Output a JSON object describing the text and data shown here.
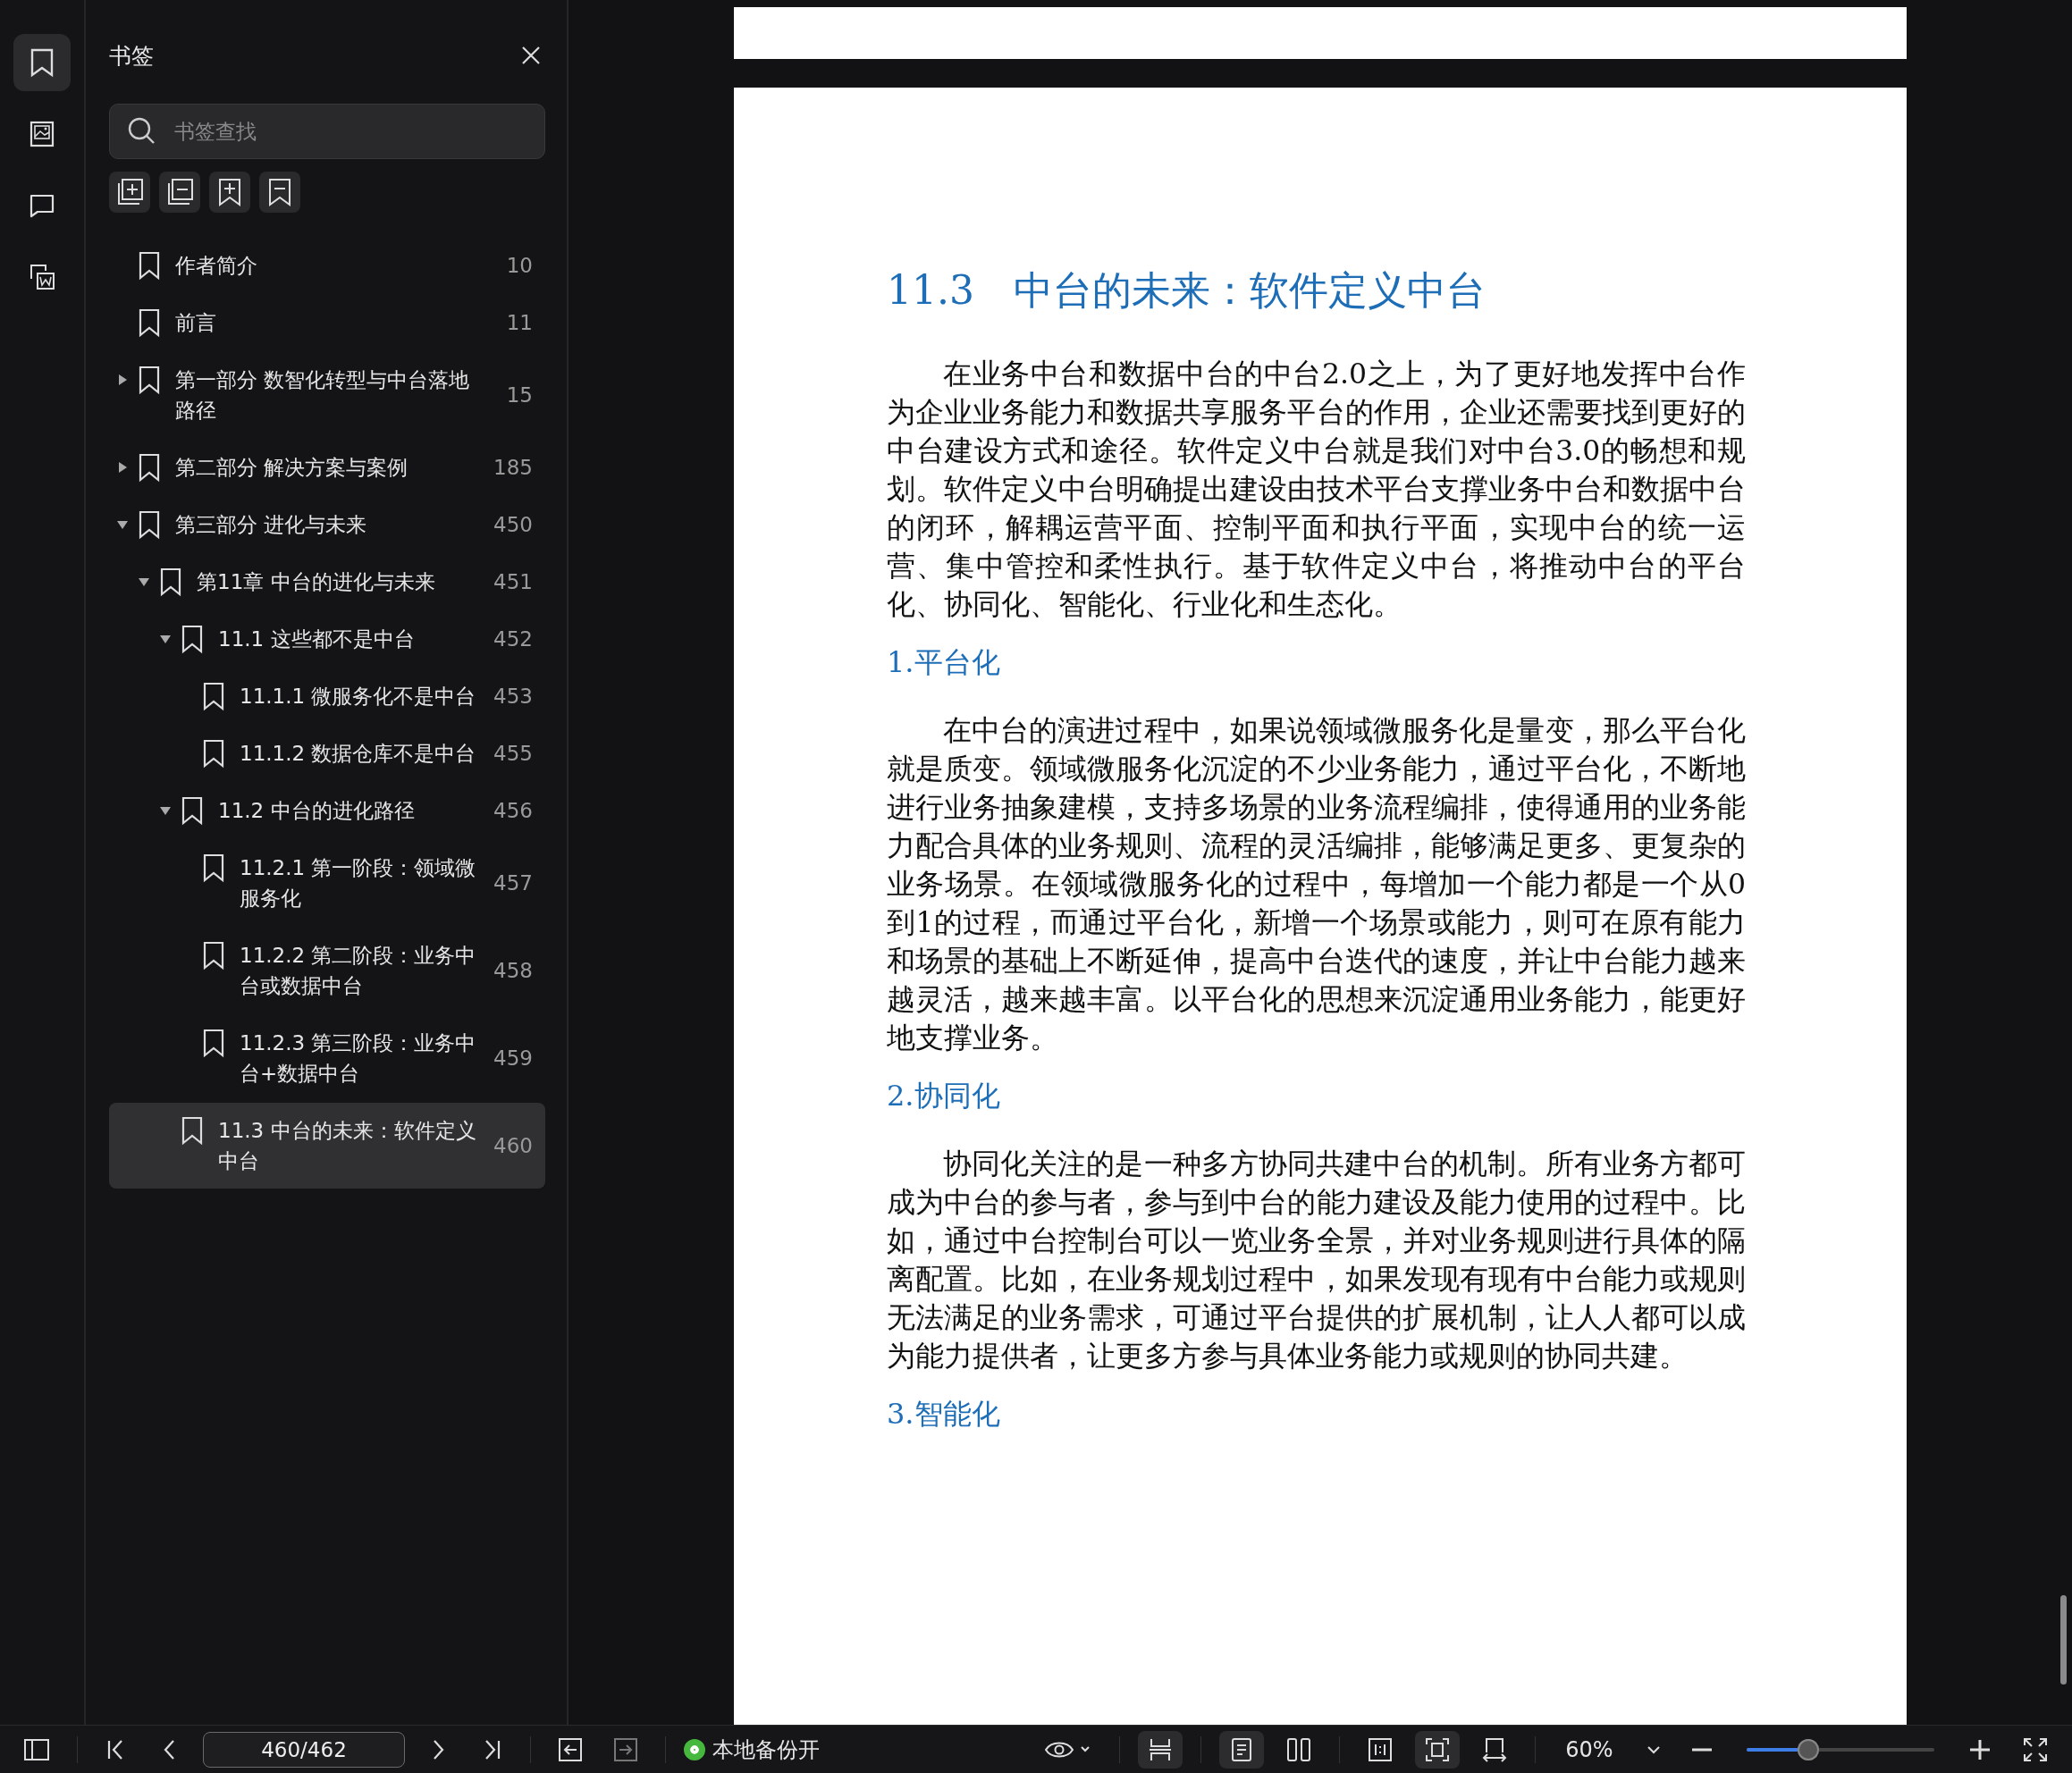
{
  "rail": [
    {
      "kind": "bookmark",
      "selected": true
    },
    {
      "kind": "image",
      "selected": false
    },
    {
      "kind": "comment",
      "selected": false
    },
    {
      "kind": "convert",
      "selected": false
    }
  ],
  "sidebar": {
    "title": "书签",
    "search": {
      "placeholder": "书签查找"
    },
    "tools": [
      {
        "kind": "expand-all"
      },
      {
        "kind": "collapse-all"
      },
      {
        "kind": "add-bookmark"
      },
      {
        "kind": "remove-bookmark"
      }
    ],
    "bookmarks": [
      {
        "label": "作者简介",
        "page": "10",
        "selected": false
      },
      {
        "label": "前言",
        "page": "11",
        "selected": false
      },
      {
        "label": "第一部分 数智化转型与中台落地路径",
        "page": "15",
        "selected": false,
        "expanded": false
      },
      {
        "label": "第二部分 解决方案与案例",
        "page": "185",
        "selected": false,
        "expanded": false
      },
      {
        "label": "第三部分 进化与未来",
        "page": "450",
        "selected": false,
        "expanded": true,
        "children": [
          {
            "label": "第11章 中台的进化与未来",
            "page": "451",
            "selected": false,
            "expanded": true,
            "children": [
              {
                "label": "11.1 这些都不是中台",
                "page": "452",
                "selected": false,
                "expanded": true,
                "children": [
                  {
                    "label": "11.1.1 微服务化不是中台",
                    "page": "453",
                    "selected": false
                  },
                  {
                    "label": "11.1.2 数据仓库不是中台",
                    "page": "455",
                    "selected": false
                  }
                ]
              },
              {
                "label": "11.2 中台的进化路径",
                "page": "456",
                "selected": false,
                "expanded": true,
                "children": [
                  {
                    "label": "11.2.1 第一阶段：领域微服务化",
                    "page": "457",
                    "selected": false
                  },
                  {
                    "label": "11.2.2 第二阶段：业务中台或数据中台",
                    "page": "458",
                    "selected": false
                  },
                  {
                    "label": "11.2.3 第三阶段：业务中台+数据中台",
                    "page": "459",
                    "selected": false
                  }
                ]
              },
              {
                "label": "11.3 中台的未来：软件定义中台",
                "page": "460",
                "selected": true
              }
            ]
          }
        ]
      }
    ]
  },
  "document": {
    "heading_number": "11.3",
    "heading": "中台的未来：软件定义中台",
    "blocks": [
      {
        "kind": "paragraph",
        "text": "在业务中台和数据中台的中台2.0之上，为了更好地发挥中台作为企业业务能力和数据共享服务平台的作用，企业还需要找到更好的中台建设方式和途径。软件定义中台就是我们对中台3.0的畅想和规划。软件定义中台明确提出建设由技术平台支撑业务中台和数据中台的闭环，解耦运营平面、控制平面和执行平面，实现中台的统一运营、集中管控和柔性执行。基于软件定义中台，将推动中台的平台化、协同化、智能化、行业化和生态化。"
      },
      {
        "kind": "subheading",
        "text": "1.平台化"
      },
      {
        "kind": "paragraph",
        "text": "在中台的演进过程中，如果说领域微服务化是量变，那么平台化就是质变。领域微服务化沉淀的不少业务能力，通过平台化，不断地进行业务抽象建模，支持多场景的业务流程编排，使得通用的业务能力配合具体的业务规则、流程的灵活编排，能够满足更多、更复杂的业务场景。在领域微服务化的过程中，每增加一个能力都是一个从0到1的过程，而通过平台化，新增一个场景或能力，则可在原有能力和场景的基础上不断延伸，提高中台迭代的速度，并让中台能力越来越灵活，越来越丰富。以平台化的思想来沉淀通用业务能力，能更好地支撑业务。"
      },
      {
        "kind": "subheading",
        "text": "2.协同化"
      },
      {
        "kind": "paragraph",
        "text": "协同化关注的是一种多方协同共建中台的机制。所有业务方都可成为中台的参与者，参与到中台的能力建设及能力使用的过程中。比如，通过中台控制台可以一览业务全景，并对业务规则进行具体的隔离配置。比如，在业务规划过程中，如果发现有现有中台能力或规则无法满足的业务需求，可通过平台提供的扩展机制，让人人都可以成为能力提供者，让更多方参与具体业务能力或规则的协同共建。"
      },
      {
        "kind": "subheading",
        "text": "3.智能化"
      }
    ]
  },
  "toolbar": {
    "page_field": "460/462",
    "history": [
      {
        "kind": "back",
        "disabled": false
      },
      {
        "kind": "forward",
        "disabled": true
      }
    ],
    "backup": {
      "label": "本地备份开",
      "on": true
    },
    "view_groups": [
      [
        {
          "kind": "continuous",
          "selected": true
        }
      ],
      [
        {
          "kind": "single",
          "selected": true
        },
        {
          "kind": "double",
          "selected": false
        }
      ],
      [
        {
          "kind": "actual",
          "selected": false
        },
        {
          "kind": "fit-page",
          "selected": true
        },
        {
          "kind": "fit-width",
          "selected": false
        }
      ]
    ],
    "zoom": {
      "value": "60%",
      "level": 0.33
    }
  }
}
